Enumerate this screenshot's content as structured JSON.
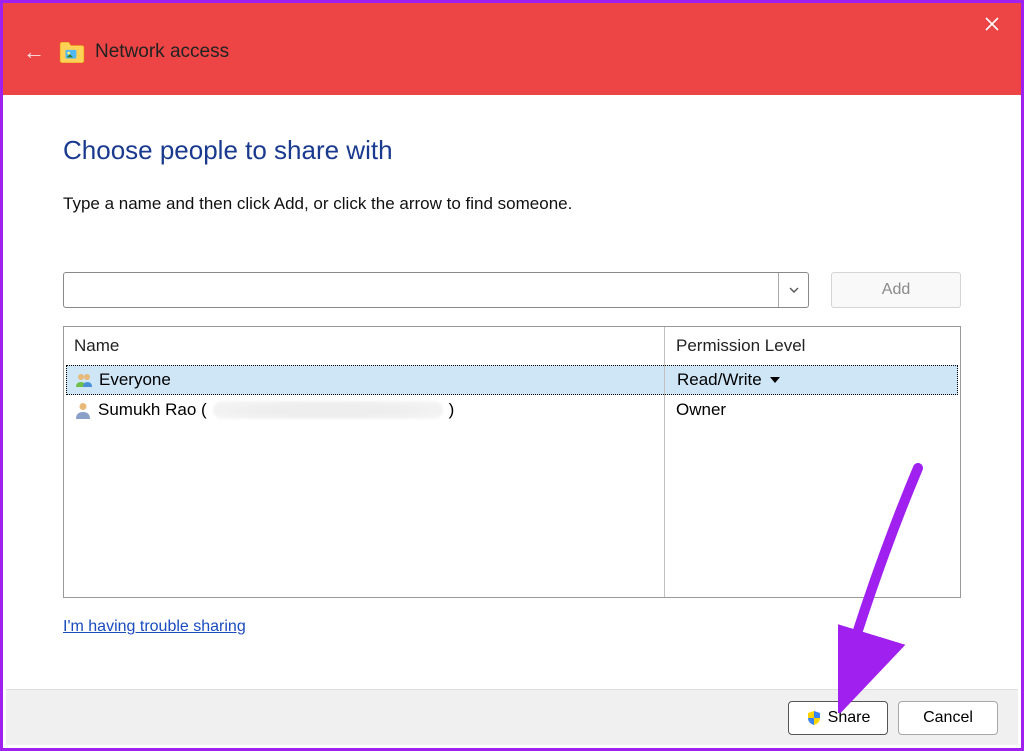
{
  "window": {
    "title": "Network access",
    "close_icon": "close"
  },
  "content": {
    "heading": "Choose people to share with",
    "instruction": "Type a name and then click Add, or click the arrow to find someone.",
    "add_button": "Add",
    "trouble_link": "I'm having trouble sharing"
  },
  "table": {
    "columns": {
      "name": "Name",
      "permission": "Permission Level"
    },
    "rows": [
      {
        "name": "Everyone",
        "permission": "Read/Write",
        "has_dropdown": true,
        "selected": true,
        "icon": "group-icon"
      },
      {
        "name_prefix": "Sumukh Rao (",
        "name_suffix": ")",
        "permission": "Owner",
        "has_dropdown": false,
        "selected": false,
        "icon": "user-icon",
        "redacted": true
      }
    ]
  },
  "footer": {
    "share": "Share",
    "cancel": "Cancel"
  }
}
